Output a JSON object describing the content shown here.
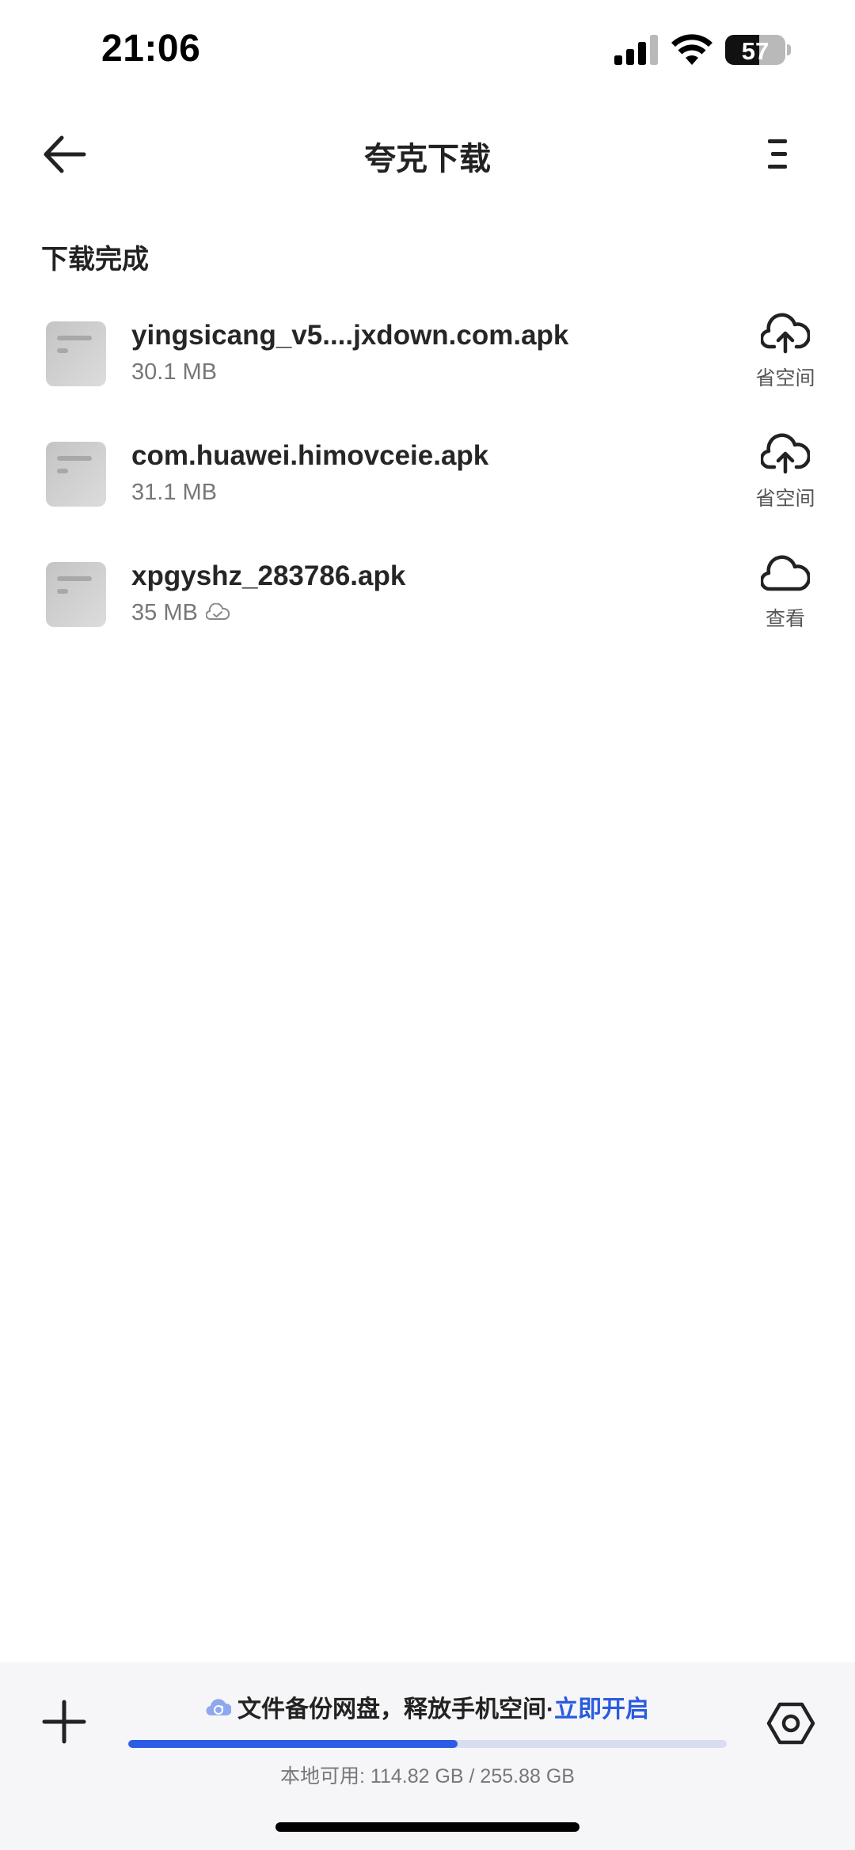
{
  "status_bar": {
    "time": "21:06",
    "battery_level": "57",
    "battery_fraction": 0.57
  },
  "header": {
    "title": "夸克下载",
    "back_icon": "arrow-left-icon",
    "menu_icon": "menu-icon"
  },
  "section": {
    "title": "下载完成"
  },
  "files": [
    {
      "name": "yingsicang_v5....jxdown.com.apk",
      "size": "30.1 MB",
      "action_label": "省空间",
      "action_icon": "cloud-upload-icon",
      "backed_up": false
    },
    {
      "name": "com.huawei.himovceie.apk",
      "size": "31.1 MB",
      "action_label": "省空间",
      "action_icon": "cloud-upload-icon",
      "backed_up": false
    },
    {
      "name": "xpgyshz_283786.apk",
      "size": "35 MB",
      "action_label": "查看",
      "action_icon": "cloud-icon",
      "backed_up": true
    }
  ],
  "bottom_bar": {
    "promo_text": "文件备份网盘，释放手机空间·",
    "promo_link": "立即开启",
    "storage_text": "本地可用: 114.82 GB / 255.88 GB",
    "storage_used_fraction": 0.55,
    "accent_color": "#2b5ce6"
  }
}
